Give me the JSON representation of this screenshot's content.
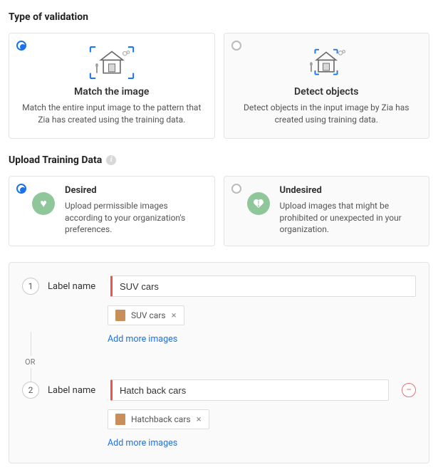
{
  "sections": {
    "validation_title": "Type of validation",
    "training_title": "Upload Training Data"
  },
  "validation_cards": {
    "match": {
      "title": "Match the image",
      "desc": "Match the entire input image to the pattern that Zia has created using the training data.",
      "selected": true
    },
    "detect": {
      "title": "Detect objects",
      "desc": "Detect objects in the input image by Zia has created using training data.",
      "selected": false
    }
  },
  "training_cards": {
    "desired": {
      "title": "Desired",
      "desc": "Upload permissible images according to your organization's preferences.",
      "selected": true
    },
    "undesired": {
      "title": "Undesired",
      "desc": "Upload images that might be prohibited or unexpected in your organization.",
      "selected": false
    }
  },
  "labels": {
    "step1": "1",
    "step2": "2",
    "field_label": "Label name",
    "or_text": "OR",
    "row1": {
      "value": "SUV cars",
      "chip": "SUV cars",
      "add_link": "Add more images"
    },
    "row2": {
      "value": "Hatch back cars",
      "chip": "Hatchback cars",
      "add_link": "Add more images"
    }
  },
  "icons": {
    "heart": "♥",
    "broken": "❤︎",
    "remove": "×",
    "minus": "−",
    "info": "i"
  }
}
